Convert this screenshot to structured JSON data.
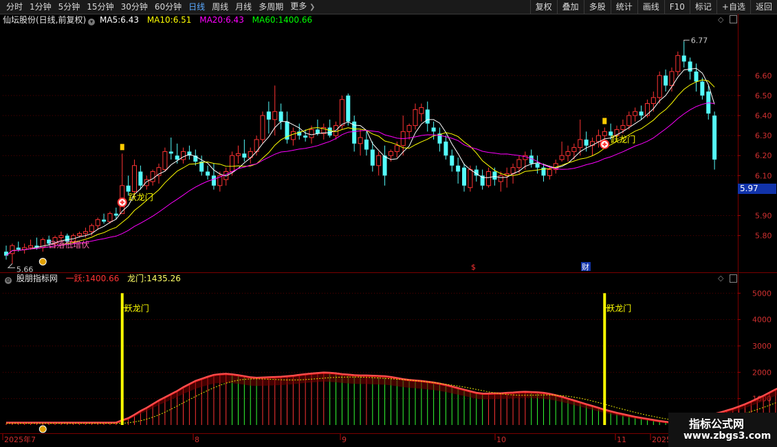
{
  "toolbar": {
    "periods": [
      "分时",
      "1分钟",
      "5分钟",
      "15分钟",
      "30分钟",
      "60分钟",
      "日线",
      "周线",
      "月线",
      "多周期",
      "更多"
    ],
    "active_period": "日线",
    "more_arrow": "❯",
    "right_buttons": [
      "复权",
      "叠加",
      "多股",
      "统计",
      "画线",
      "F10",
      "标记",
      "+自选",
      "返回"
    ]
  },
  "stock": {
    "title": "仙坛股份(日线,前复权)",
    "ma5_label": "MA5:",
    "ma5": "6.43",
    "ma10_label": "MA10:",
    "ma10": "6.51",
    "ma20_label": "MA20:",
    "ma20": "6.43",
    "ma60_label": "MA60:",
    "ma60": "1400.66"
  },
  "price_axis": {
    "ticks": [
      "6.60",
      "6.50",
      "6.40",
      "6.30",
      "6.20",
      "6.10",
      "5.90",
      "5.80"
    ],
    "current": "5.97"
  },
  "annotations": {
    "high": "6.77",
    "low": "5.66",
    "dragon_gate": "跃龙门",
    "bottom_hint": "日落低增伏",
    "dollar": "$",
    "finance": "财"
  },
  "indicator": {
    "name": "股朋指标网",
    "s1_label": "一跃:",
    "s1_value": "1400.66",
    "s2_label": "龙门:",
    "s2_value": "1435.26",
    "axis_ticks": [
      "5000",
      "4000",
      "3000",
      "2000",
      "1000"
    ],
    "signal_label": "跃龙门"
  },
  "date_axis": {
    "labels": [
      "2025年7",
      "8",
      "9",
      "10",
      "11",
      "2025"
    ]
  },
  "watermark": {
    "line1": "指标公式网",
    "line2": "www.zbgs3.com"
  },
  "colors": {
    "up": "#ff3333",
    "down": "#54fcfc",
    "ma5": "#ffffff",
    "ma10": "#ffff00",
    "ma20": "#ff00ff",
    "ma60": "#00ff00",
    "signal": "#ffff00",
    "active_tab": "#5aa9ff"
  },
  "chart_data": {
    "type": "candlestick",
    "price_range": [
      5.62,
      6.84
    ],
    "candles": [
      {
        "o": 5.72,
        "h": 5.75,
        "l": 5.68,
        "c": 5.7
      },
      {
        "o": 5.71,
        "h": 5.76,
        "l": 5.66,
        "c": 5.75
      },
      {
        "o": 5.74,
        "h": 5.77,
        "l": 5.72,
        "c": 5.73
      },
      {
        "o": 5.73,
        "h": 5.76,
        "l": 5.71,
        "c": 5.74
      },
      {
        "o": 5.74,
        "h": 5.78,
        "l": 5.73,
        "c": 5.75
      },
      {
        "o": 5.75,
        "h": 5.79,
        "l": 5.73,
        "c": 5.74
      },
      {
        "o": 5.74,
        "h": 5.79,
        "l": 5.72,
        "c": 5.78
      },
      {
        "o": 5.78,
        "h": 5.8,
        "l": 5.75,
        "c": 5.76
      },
      {
        "o": 5.76,
        "h": 5.8,
        "l": 5.74,
        "c": 5.79
      },
      {
        "o": 5.79,
        "h": 5.82,
        "l": 5.77,
        "c": 5.8
      },
      {
        "o": 5.8,
        "h": 5.81,
        "l": 5.76,
        "c": 5.77
      },
      {
        "o": 5.77,
        "h": 5.81,
        "l": 5.76,
        "c": 5.8
      },
      {
        "o": 5.8,
        "h": 5.82,
        "l": 5.79,
        "c": 5.81
      },
      {
        "o": 5.81,
        "h": 5.84,
        "l": 5.79,
        "c": 5.82
      },
      {
        "o": 5.82,
        "h": 5.86,
        "l": 5.8,
        "c": 5.85
      },
      {
        "o": 5.85,
        "h": 5.89,
        "l": 5.83,
        "c": 5.88
      },
      {
        "o": 5.88,
        "h": 5.91,
        "l": 5.86,
        "c": 5.87
      },
      {
        "o": 5.87,
        "h": 5.92,
        "l": 5.86,
        "c": 5.91
      },
      {
        "o": 5.91,
        "h": 5.94,
        "l": 5.88,
        "c": 5.9
      },
      {
        "o": 5.91,
        "h": 6.21,
        "l": 5.98,
        "c": 6.05
      },
      {
        "o": 6.05,
        "h": 6.1,
        "l": 6.0,
        "c": 6.02
      },
      {
        "o": 6.02,
        "h": 6.18,
        "l": 6.0,
        "c": 6.15
      },
      {
        "o": 6.12,
        "h": 6.15,
        "l": 6.03,
        "c": 6.05
      },
      {
        "o": 6.05,
        "h": 6.1,
        "l": 6.03,
        "c": 6.08
      },
      {
        "o": 6.07,
        "h": 6.13,
        "l": 6.05,
        "c": 6.12
      },
      {
        "o": 6.1,
        "h": 6.16,
        "l": 6.06,
        "c": 6.14
      },
      {
        "o": 6.13,
        "h": 6.24,
        "l": 6.12,
        "c": 6.22
      },
      {
        "o": 6.22,
        "h": 6.29,
        "l": 6.18,
        "c": 6.21
      },
      {
        "o": 6.2,
        "h": 6.26,
        "l": 6.16,
        "c": 6.18
      },
      {
        "o": 6.18,
        "h": 6.24,
        "l": 6.16,
        "c": 6.22
      },
      {
        "o": 6.22,
        "h": 6.25,
        "l": 6.18,
        "c": 6.2
      },
      {
        "o": 6.2,
        "h": 6.23,
        "l": 6.15,
        "c": 6.17
      },
      {
        "o": 6.17,
        "h": 6.2,
        "l": 6.1,
        "c": 6.12
      },
      {
        "o": 6.12,
        "h": 6.15,
        "l": 6.08,
        "c": 6.1
      },
      {
        "o": 6.1,
        "h": 6.16,
        "l": 6.03,
        "c": 6.05
      },
      {
        "o": 6.05,
        "h": 6.12,
        "l": 6.02,
        "c": 6.1
      },
      {
        "o": 6.08,
        "h": 6.14,
        "l": 6.05,
        "c": 6.12
      },
      {
        "o": 6.12,
        "h": 6.22,
        "l": 6.1,
        "c": 6.2
      },
      {
        "o": 6.2,
        "h": 6.25,
        "l": 6.16,
        "c": 6.21
      },
      {
        "o": 6.21,
        "h": 6.28,
        "l": 6.17,
        "c": 6.19
      },
      {
        "o": 6.19,
        "h": 6.24,
        "l": 6.16,
        "c": 6.22
      },
      {
        "o": 6.22,
        "h": 6.3,
        "l": 6.2,
        "c": 6.28
      },
      {
        "o": 6.28,
        "h": 6.42,
        "l": 6.26,
        "c": 6.4
      },
      {
        "o": 6.42,
        "h": 6.47,
        "l": 6.31,
        "c": 6.38
      },
      {
        "o": 6.38,
        "h": 6.55,
        "l": 6.3,
        "c": 6.42
      },
      {
        "o": 6.42,
        "h": 6.46,
        "l": 6.33,
        "c": 6.37
      },
      {
        "o": 6.37,
        "h": 6.42,
        "l": 6.26,
        "c": 6.28
      },
      {
        "o": 6.28,
        "h": 6.34,
        "l": 6.25,
        "c": 6.32
      },
      {
        "o": 6.32,
        "h": 6.36,
        "l": 6.28,
        "c": 6.3
      },
      {
        "o": 6.3,
        "h": 6.33,
        "l": 6.27,
        "c": 6.29
      },
      {
        "o": 6.29,
        "h": 6.35,
        "l": 6.26,
        "c": 6.33
      },
      {
        "o": 6.33,
        "h": 6.38,
        "l": 6.3,
        "c": 6.31
      },
      {
        "o": 6.31,
        "h": 6.36,
        "l": 6.28,
        "c": 6.34
      },
      {
        "o": 6.34,
        "h": 6.38,
        "l": 6.29,
        "c": 6.3
      },
      {
        "o": 6.3,
        "h": 6.37,
        "l": 6.28,
        "c": 6.35
      },
      {
        "o": 6.35,
        "h": 6.5,
        "l": 6.33,
        "c": 6.48
      },
      {
        "o": 6.5,
        "h": 6.51,
        "l": 6.35,
        "c": 6.37
      },
      {
        "o": 6.37,
        "h": 6.4,
        "l": 6.22,
        "c": 6.26
      },
      {
        "o": 6.26,
        "h": 6.33,
        "l": 6.2,
        "c": 6.29
      },
      {
        "o": 6.28,
        "h": 6.32,
        "l": 6.2,
        "c": 6.23
      },
      {
        "o": 6.23,
        "h": 6.27,
        "l": 6.12,
        "c": 6.15
      },
      {
        "o": 6.15,
        "h": 6.22,
        "l": 6.1,
        "c": 6.2
      },
      {
        "o": 6.2,
        "h": 6.25,
        "l": 6.05,
        "c": 6.1
      },
      {
        "o": 6.2,
        "h": 6.23,
        "l": 6.17,
        "c": 6.22
      },
      {
        "o": 6.22,
        "h": 6.27,
        "l": 6.19,
        "c": 6.25
      },
      {
        "o": 6.25,
        "h": 6.4,
        "l": 6.2,
        "c": 6.32
      },
      {
        "o": 6.32,
        "h": 6.36,
        "l": 6.28,
        "c": 6.35
      },
      {
        "o": 6.35,
        "h": 6.46,
        "l": 6.33,
        "c": 6.43
      },
      {
        "o": 6.41,
        "h": 6.46,
        "l": 6.37,
        "c": 6.44
      },
      {
        "o": 6.43,
        "h": 6.47,
        "l": 6.32,
        "c": 6.36
      },
      {
        "o": 6.34,
        "h": 6.37,
        "l": 6.28,
        "c": 6.32
      },
      {
        "o": 6.31,
        "h": 6.34,
        "l": 6.22,
        "c": 6.26
      },
      {
        "o": 6.27,
        "h": 6.3,
        "l": 6.18,
        "c": 6.2
      },
      {
        "o": 6.2,
        "h": 6.23,
        "l": 6.12,
        "c": 6.15
      },
      {
        "o": 6.15,
        "h": 6.19,
        "l": 6.06,
        "c": 6.12
      },
      {
        "o": 6.14,
        "h": 6.16,
        "l": 6.02,
        "c": 6.05
      },
      {
        "o": 6.04,
        "h": 6.15,
        "l": 6.02,
        "c": 6.13
      },
      {
        "o": 6.13,
        "h": 6.15,
        "l": 6.07,
        "c": 6.1
      },
      {
        "o": 6.1,
        "h": 6.13,
        "l": 6.03,
        "c": 6.05
      },
      {
        "o": 6.05,
        "h": 6.14,
        "l": 6.04,
        "c": 6.12
      },
      {
        "o": 6.12,
        "h": 6.14,
        "l": 6.05,
        "c": 6.08
      },
      {
        "o": 6.07,
        "h": 6.12,
        "l": 6.02,
        "c": 6.1
      },
      {
        "o": 6.1,
        "h": 6.14,
        "l": 6.04,
        "c": 6.11
      },
      {
        "o": 6.11,
        "h": 6.16,
        "l": 6.06,
        "c": 6.14
      },
      {
        "o": 6.14,
        "h": 6.2,
        "l": 6.11,
        "c": 6.18
      },
      {
        "o": 6.18,
        "h": 6.22,
        "l": 6.13,
        "c": 6.2
      },
      {
        "o": 6.2,
        "h": 6.23,
        "l": 6.14,
        "c": 6.16
      },
      {
        "o": 6.16,
        "h": 6.2,
        "l": 6.11,
        "c": 6.14
      },
      {
        "o": 6.14,
        "h": 6.16,
        "l": 6.07,
        "c": 6.1
      },
      {
        "o": 6.1,
        "h": 6.15,
        "l": 6.08,
        "c": 6.13
      },
      {
        "o": 6.13,
        "h": 6.18,
        "l": 6.11,
        "c": 6.16
      },
      {
        "o": 6.18,
        "h": 6.27,
        "l": 6.17,
        "c": 6.2
      },
      {
        "o": 6.2,
        "h": 6.25,
        "l": 6.17,
        "c": 6.22
      },
      {
        "o": 6.22,
        "h": 6.26,
        "l": 6.18,
        "c": 6.24
      },
      {
        "o": 6.24,
        "h": 6.38,
        "l": 6.2,
        "c": 6.28
      },
      {
        "o": 6.28,
        "h": 6.32,
        "l": 6.22,
        "c": 6.25
      },
      {
        "o": 6.25,
        "h": 6.29,
        "l": 6.2,
        "c": 6.27
      },
      {
        "o": 6.27,
        "h": 6.33,
        "l": 6.24,
        "c": 6.3
      },
      {
        "o": 6.3,
        "h": 6.34,
        "l": 6.27,
        "c": 6.32
      },
      {
        "o": 6.32,
        "h": 6.36,
        "l": 6.28,
        "c": 6.3
      },
      {
        "o": 6.3,
        "h": 6.35,
        "l": 6.29,
        "c": 6.33
      },
      {
        "o": 6.33,
        "h": 6.38,
        "l": 6.31,
        "c": 6.35
      },
      {
        "o": 6.35,
        "h": 6.42,
        "l": 6.33,
        "c": 6.4
      },
      {
        "o": 6.4,
        "h": 6.44,
        "l": 6.37,
        "c": 6.42
      },
      {
        "o": 6.42,
        "h": 6.45,
        "l": 6.38,
        "c": 6.4
      },
      {
        "o": 6.4,
        "h": 6.48,
        "l": 6.39,
        "c": 6.46
      },
      {
        "o": 6.46,
        "h": 6.52,
        "l": 6.42,
        "c": 6.49
      },
      {
        "o": 6.49,
        "h": 6.62,
        "l": 6.46,
        "c": 6.6
      },
      {
        "o": 6.6,
        "h": 6.63,
        "l": 6.52,
        "c": 6.55
      },
      {
        "o": 6.55,
        "h": 6.64,
        "l": 6.52,
        "c": 6.62
      },
      {
        "o": 6.62,
        "h": 6.72,
        "l": 6.6,
        "c": 6.7
      },
      {
        "o": 6.7,
        "h": 6.77,
        "l": 6.64,
        "c": 6.67
      },
      {
        "o": 6.67,
        "h": 6.69,
        "l": 6.58,
        "c": 6.62
      },
      {
        "o": 6.62,
        "h": 6.66,
        "l": 6.52,
        "c": 6.57
      },
      {
        "o": 6.57,
        "h": 6.59,
        "l": 6.48,
        "c": 6.5
      },
      {
        "o": 6.52,
        "h": 6.55,
        "l": 6.38,
        "c": 6.41
      },
      {
        "o": 6.4,
        "h": 6.42,
        "l": 6.13,
        "c": 6.18
      }
    ],
    "signal_index": [
      19,
      98
    ],
    "indicator_range": [
      0,
      5400
    ],
    "indicator_values": [
      60,
      60,
      60,
      60,
      60,
      60,
      60,
      60,
      60,
      60,
      60,
      60,
      60,
      60,
      60,
      60,
      60,
      60,
      60,
      150,
      230,
      360,
      500,
      620,
      760,
      900,
      1020,
      1140,
      1260,
      1400,
      1520,
      1640,
      1720,
      1800,
      1870,
      1900,
      1910,
      1890,
      1860,
      1820,
      1780,
      1760,
      1770,
      1780,
      1790,
      1800,
      1820,
      1840,
      1870,
      1900,
      1920,
      1940,
      1960,
      1950,
      1930,
      1900,
      1880,
      1860,
      1850,
      1850,
      1840,
      1830,
      1820,
      1790,
      1750,
      1710,
      1680,
      1660,
      1640,
      1610,
      1580,
      1540,
      1490,
      1430,
      1370,
      1310,
      1250,
      1190,
      1160,
      1160,
      1170,
      1170,
      1190,
      1200,
      1220,
      1230,
      1220,
      1210,
      1190,
      1150,
      1100,
      1040,
      970,
      900,
      830,
      760,
      690,
      620,
      550,
      490,
      430,
      380,
      330,
      280,
      240,
      200,
      160,
      120,
      90,
      60,
      120,
      160,
      200,
      240,
      280,
      330,
      390,
      450,
      520,
      590,
      670,
      760,
      860,
      970,
      1080,
      1200,
      1320,
      1420,
      1520,
      1600,
      1660,
      1700,
      1700,
      1680,
      1640,
      1560,
      1430
    ]
  }
}
